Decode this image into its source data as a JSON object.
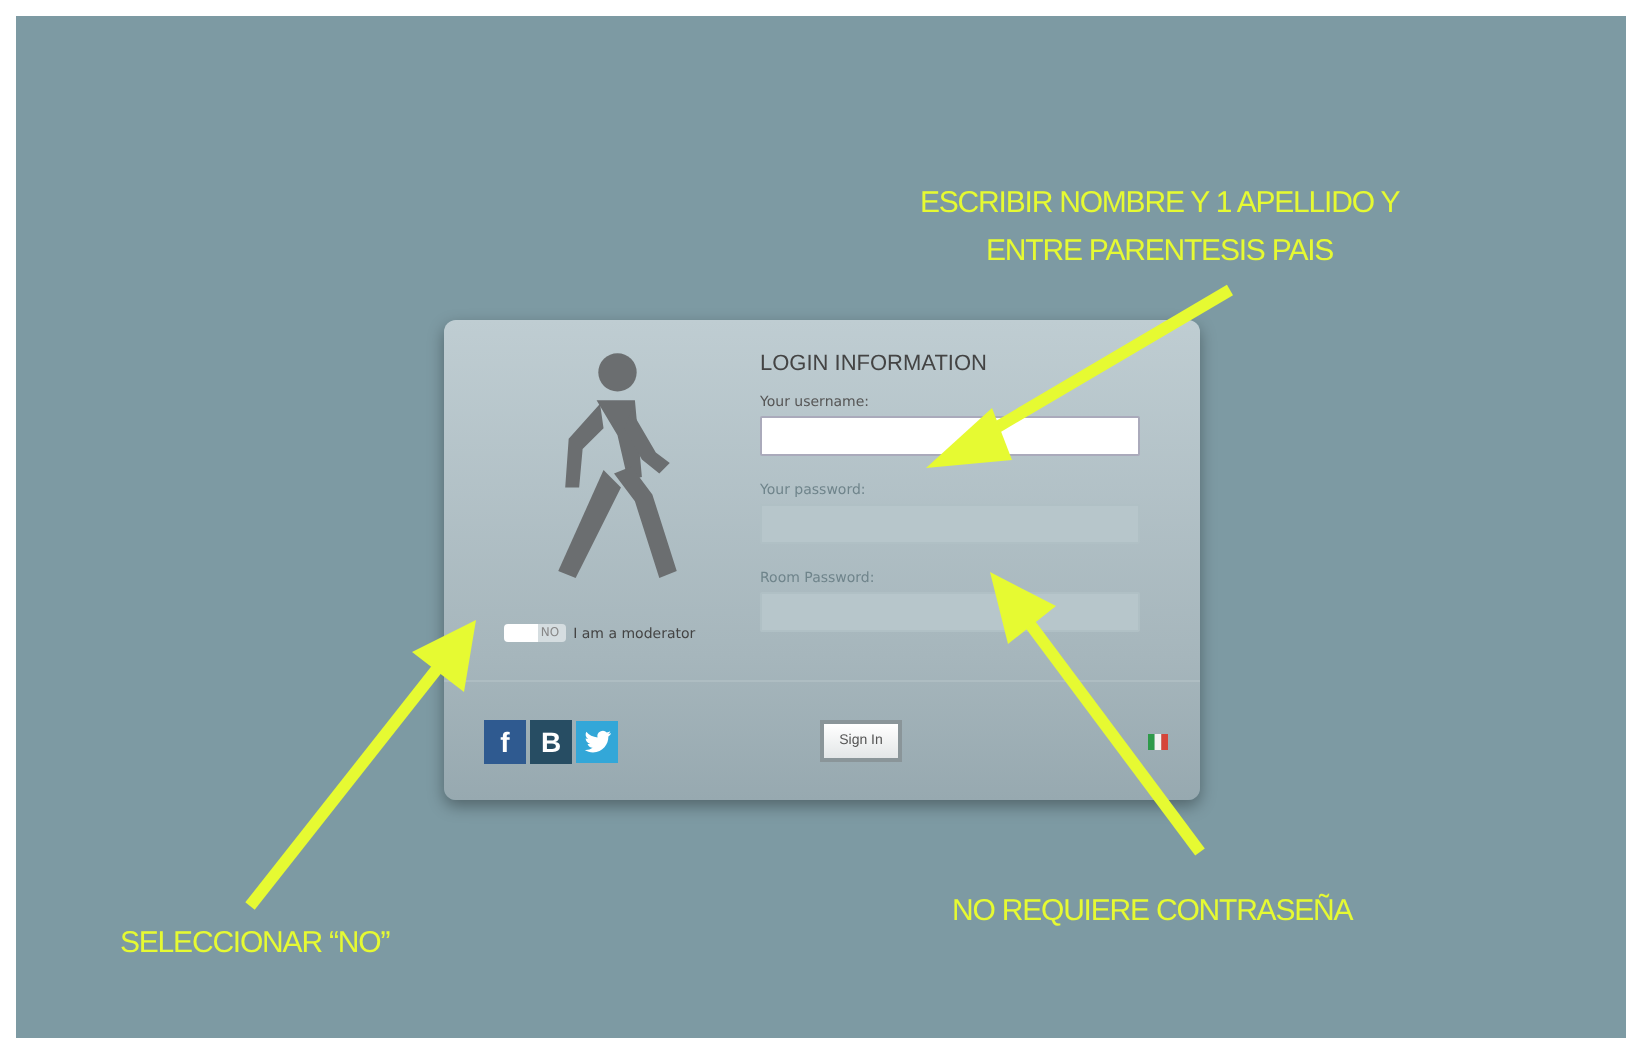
{
  "login": {
    "title": "LOGIN INFORMATION",
    "fields": [
      {
        "label": "Your username:",
        "disabled": false
      },
      {
        "label": "Your password:",
        "disabled": true
      },
      {
        "label": "Room Password:",
        "disabled": true
      }
    ],
    "moderator": {
      "toggle": "NO",
      "on": false,
      "label": "I am a moderator"
    },
    "social": [
      "f",
      "B"
    ],
    "button": "Sign In"
  },
  "annotations": [
    {
      "lines": [
        "ESCRIBIR NOMBRE Y 1 APELLIDO Y",
        "ENTRE PARENTESIS PAIS"
      ]
    },
    {
      "lines": [
        "NO REQUIERE CONTRASEÑA"
      ]
    },
    {
      "lines": [
        "SELECCIONAR “NO”"
      ]
    }
  ]
}
